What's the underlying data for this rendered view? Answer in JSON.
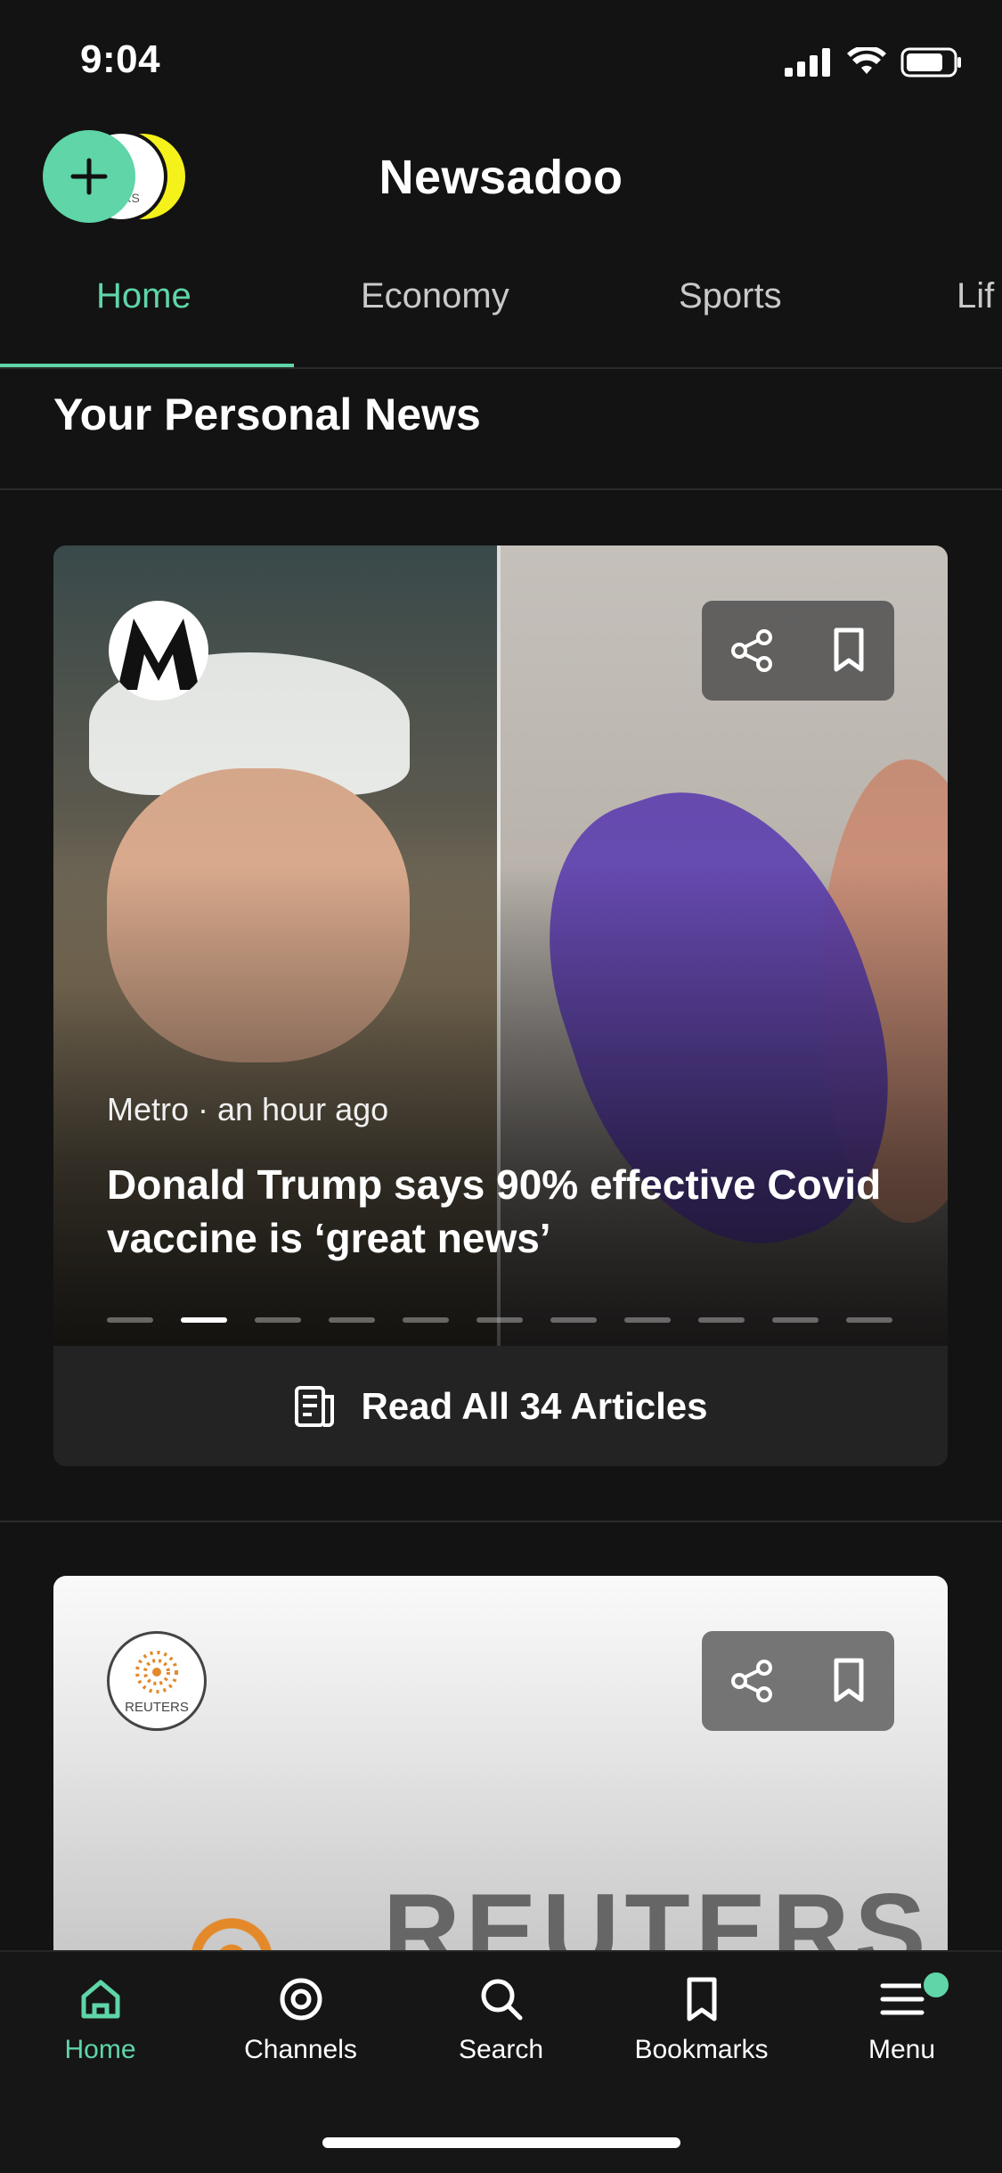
{
  "status_bar": {
    "time": "9:04"
  },
  "header": {
    "brand": "Newsadoo"
  },
  "avatar_small_text": "ERS",
  "tabs": [
    {
      "label": "Home",
      "active": true
    },
    {
      "label": "Economy"
    },
    {
      "label": "Sports"
    },
    {
      "label": "Lif"
    }
  ],
  "section_title": "Your Personal News",
  "card1": {
    "source": "Metro",
    "time": "an hour ago",
    "meta_text": "Metro · an hour ago",
    "headline": "Donald Trump says 90% effective Covid vaccine is ‘great news’",
    "slide_count": 11,
    "active_slide": 2,
    "read_all_label": "Read All 34 Articles"
  },
  "card2": {
    "source_logo_label": "REUTERS",
    "banner_text": "REUTERS"
  },
  "bottom_nav": [
    {
      "label": "Home",
      "icon": "home-icon",
      "active": true
    },
    {
      "label": "Channels",
      "icon": "channels-icon"
    },
    {
      "label": "Search",
      "icon": "search-icon"
    },
    {
      "label": "Bookmarks",
      "icon": "bookmark-icon"
    },
    {
      "label": "Menu",
      "icon": "menu-icon",
      "badge": true
    }
  ],
  "colors": {
    "accent": "#5fd5a8",
    "background": "#131313"
  }
}
